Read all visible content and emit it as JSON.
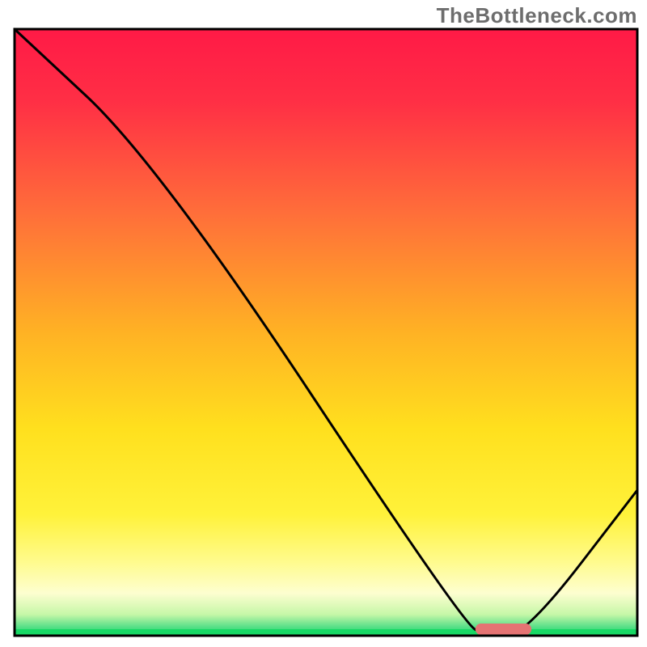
{
  "watermark": "TheBottleneck.com",
  "chart_data": {
    "type": "line",
    "title": "",
    "xlabel": "",
    "ylabel": "",
    "xlim": [
      0,
      100
    ],
    "ylim": [
      0,
      100
    ],
    "x": [
      0,
      23,
      72,
      76,
      82,
      100
    ],
    "values": [
      100,
      78,
      2,
      0,
      0,
      24
    ],
    "optimal_marker": {
      "x_start": 74,
      "x_end": 83,
      "y": 0
    },
    "gradient_stops": [
      {
        "offset": 0.0,
        "color": "#ff1a46"
      },
      {
        "offset": 0.12,
        "color": "#ff2f45"
      },
      {
        "offset": 0.3,
        "color": "#ff6d3a"
      },
      {
        "offset": 0.5,
        "color": "#ffb224"
      },
      {
        "offset": 0.66,
        "color": "#ffe01e"
      },
      {
        "offset": 0.8,
        "color": "#fff23a"
      },
      {
        "offset": 0.88,
        "color": "#fffb8f"
      },
      {
        "offset": 0.93,
        "color": "#fdfed0"
      },
      {
        "offset": 0.965,
        "color": "#c6f7a8"
      },
      {
        "offset": 0.985,
        "color": "#5be089"
      },
      {
        "offset": 1.0,
        "color": "#17d965"
      }
    ],
    "colors": {
      "line": "#000000",
      "marker": "#e57373",
      "border": "#000000",
      "bottom_green": "#17d965"
    }
  }
}
